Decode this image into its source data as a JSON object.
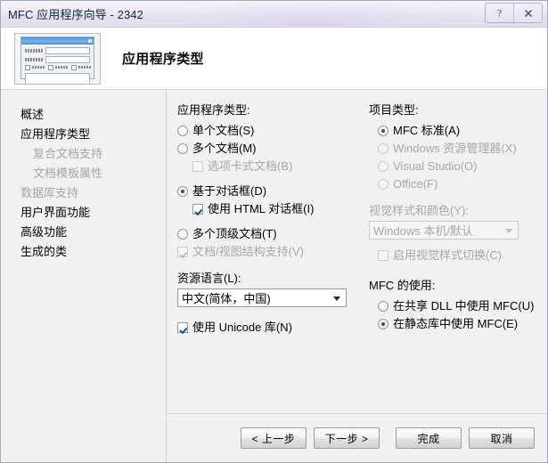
{
  "window": {
    "title": "MFC 应用程序向导 - 2342",
    "caption_buttons": [
      {
        "name": "help-button",
        "glyph": "?"
      },
      {
        "name": "close-button",
        "glyph": "✕"
      }
    ]
  },
  "header": {
    "page_title": "应用程序类型",
    "preview_alt": "dialog-preview-thumbnail"
  },
  "sidebar": {
    "items": [
      {
        "label": "概述",
        "state": "normal",
        "level": 0
      },
      {
        "label": "应用程序类型",
        "state": "current",
        "level": 0
      },
      {
        "label": "复合文档支持",
        "state": "disabled",
        "level": 1
      },
      {
        "label": "文档模板属性",
        "state": "disabled",
        "level": 1
      },
      {
        "label": "数据库支持",
        "state": "disabled",
        "level": 0
      },
      {
        "label": "用户界面功能",
        "state": "normal",
        "level": 0
      },
      {
        "label": "高级功能",
        "state": "normal",
        "level": 0
      },
      {
        "label": "生成的类",
        "state": "normal",
        "level": 0
      }
    ]
  },
  "app_type": {
    "group_label": "应用程序类型:",
    "options": [
      {
        "type": "radio",
        "label": "单个文档(S)",
        "accel": "S",
        "checked": false,
        "disabled": false,
        "indent": 0
      },
      {
        "type": "radio",
        "label": "多个文档(M)",
        "accel": "M",
        "checked": false,
        "disabled": false,
        "indent": 0
      },
      {
        "type": "checkbox",
        "label": "选项卡式文档(B)",
        "accel": "B",
        "checked": false,
        "disabled": true,
        "indent": 1
      },
      {
        "type": "radio",
        "label": "基于对话框(D)",
        "accel": "D",
        "checked": true,
        "disabled": false,
        "indent": 0
      },
      {
        "type": "checkbox",
        "label": "使用 HTML 对话框(I)",
        "accel": "I",
        "checked": true,
        "disabled": false,
        "indent": 1
      },
      {
        "type": "radio",
        "label": "多个顶级文档(T)",
        "accel": "T",
        "checked": false,
        "disabled": false,
        "indent": 0
      },
      {
        "type": "checkbox",
        "label": "文档/视图结构支持(V)",
        "accel": "V",
        "checked": true,
        "disabled": true,
        "indent": 0
      }
    ]
  },
  "resource_language": {
    "label": "资源语言(L):",
    "value": "中文(简体，中国)",
    "disabled": false
  },
  "unicode": {
    "label": "使用 Unicode 库(N)",
    "accel": "N",
    "checked": true,
    "disabled": false
  },
  "project_type": {
    "group_label": "项目类型:",
    "options": [
      {
        "type": "radio",
        "label": "MFC 标准(A)",
        "accel": "A",
        "checked": true,
        "disabled": false
      },
      {
        "type": "radio",
        "label": "Windows 资源管理器(X)",
        "accel": "X",
        "checked": false,
        "disabled": true
      },
      {
        "type": "radio",
        "label": "Visual Studio(O)",
        "accel": "O",
        "checked": false,
        "disabled": true
      },
      {
        "type": "radio",
        "label": "Office(F)",
        "accel": "F",
        "checked": false,
        "disabled": true
      }
    ]
  },
  "visual_style": {
    "label": "视觉样式和颜色(Y):",
    "value": "Windows 本机/默认",
    "disabled": true,
    "switch_checkbox": {
      "label": "启用视觉样式切换(C)",
      "accel": "C",
      "checked": false,
      "disabled": true
    }
  },
  "mfc_usage": {
    "group_label": "MFC 的使用:",
    "options": [
      {
        "type": "radio",
        "label": "在共享 DLL 中使用 MFC(U)",
        "accel": "U",
        "checked": false,
        "disabled": false
      },
      {
        "type": "radio",
        "label": "在静态库中使用 MFC(E)",
        "accel": "E",
        "checked": true,
        "disabled": false
      }
    ]
  },
  "footer": {
    "buttons": [
      {
        "name": "back-button",
        "label": "< 上一步"
      },
      {
        "name": "next-button",
        "label": "下一步 >"
      },
      {
        "name": "finish-button",
        "label": "完成"
      },
      {
        "name": "cancel-button",
        "label": "取消"
      }
    ]
  },
  "colors": {
    "accent": "#23557e",
    "title_bar": "#e6e2f0",
    "panel_bg": "#f1f1f1",
    "disabled_text": "#a6a6a6"
  }
}
